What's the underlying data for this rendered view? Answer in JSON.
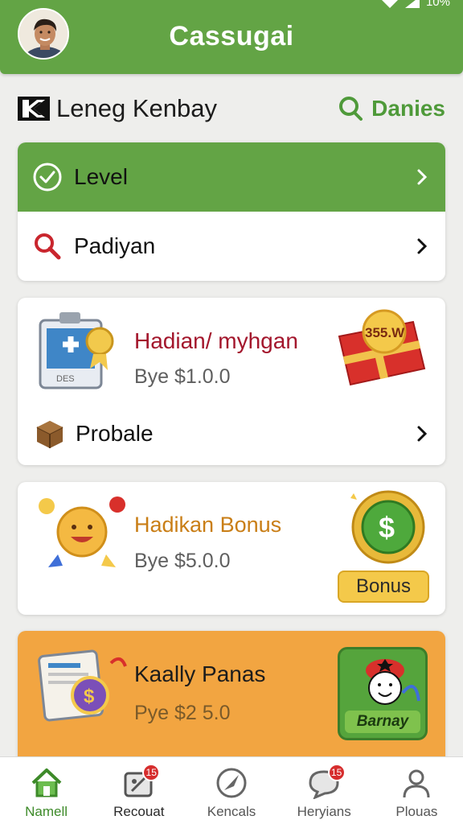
{
  "status_bar": {
    "battery": "10%"
  },
  "header": {
    "title": "Cassugai"
  },
  "account": {
    "name": "Leneg Kenbay",
    "search_label": "Danies"
  },
  "menu": [
    {
      "label": "Level",
      "icon": "check-circle-icon"
    },
    {
      "label": "Padiyan",
      "icon": "search-icon"
    }
  ],
  "reward_card": {
    "title": "Hadian/ myhgan",
    "subtitle": "Bye $1.0.0",
    "calendar_label": "DES",
    "gift_label": "355.W",
    "row_label": "Probale"
  },
  "bonus_card": {
    "title": "Hadikan Bonus",
    "subtitle": "Bye $5.0.0",
    "badge_label": "Bonus"
  },
  "panas_card": {
    "title": "Kaally Panas",
    "subtitle": "Pye $2 5.0",
    "character_label": "Barnay"
  },
  "bottom_nav": [
    {
      "label": "Namell",
      "icon": "home-icon"
    },
    {
      "label": "Recouat",
      "icon": "tag-icon",
      "badge": "15"
    },
    {
      "label": "Kencals",
      "icon": "compass-icon"
    },
    {
      "label": "Heryians",
      "icon": "chat-icon",
      "badge": "15"
    },
    {
      "label": "Plouas",
      "icon": "profile-icon"
    }
  ],
  "colors": {
    "primary": "#63a445",
    "accent_red": "#a3162c",
    "accent_gold": "#c97e16",
    "card_orange": "#f2a541"
  }
}
